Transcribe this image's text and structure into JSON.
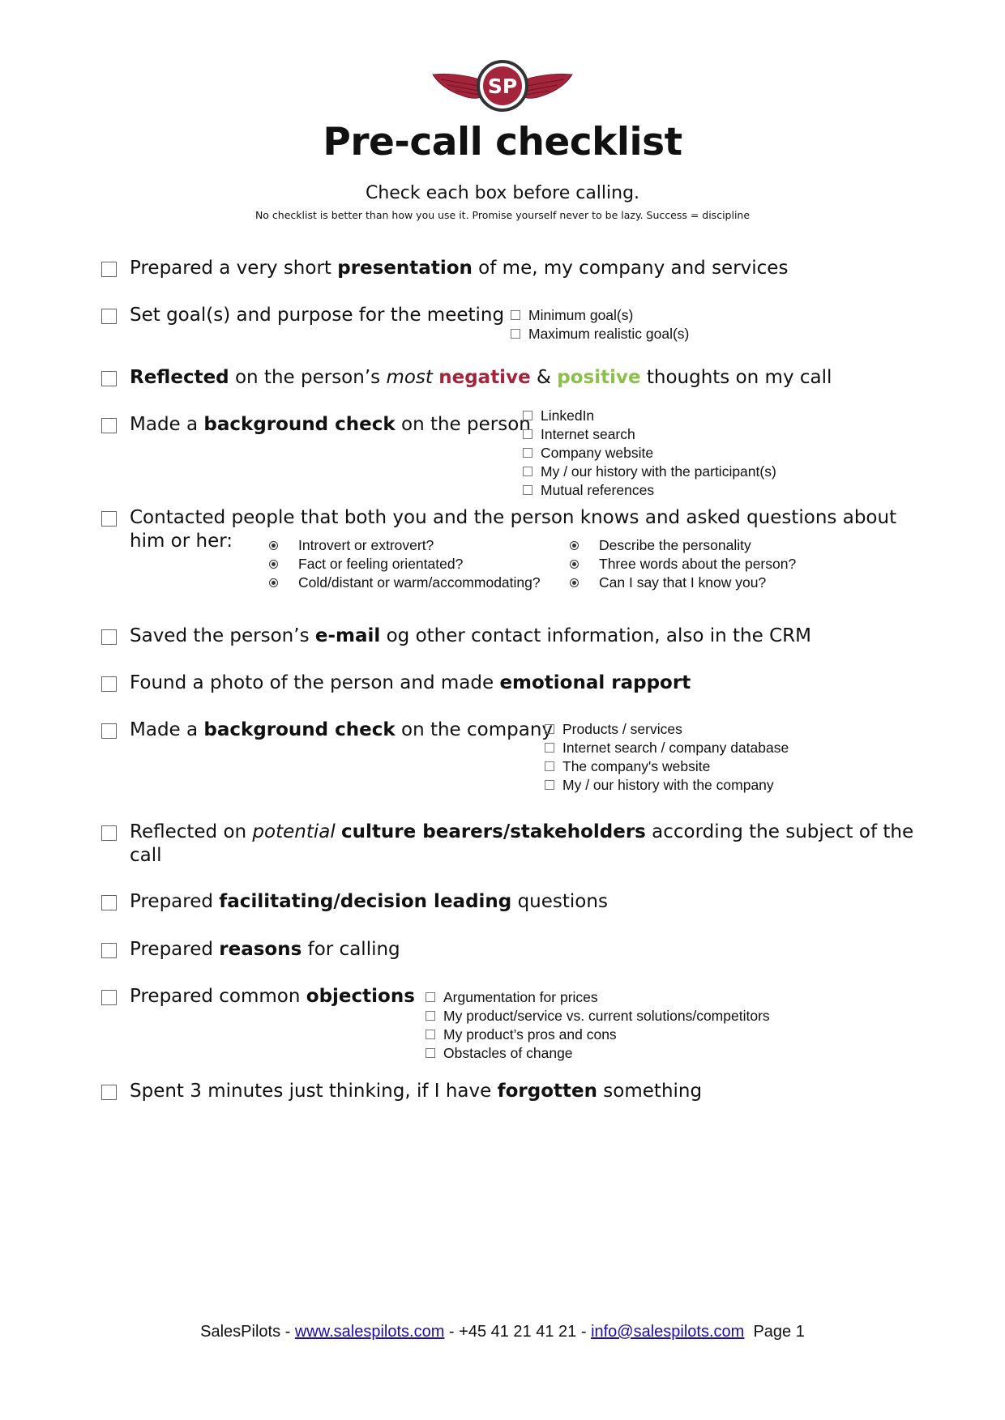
{
  "header": {
    "logo_text": "SP",
    "title": "Pre-call checklist",
    "subtitle": "Check each box before calling.",
    "tagline": "No checklist is better than how you use it. Promise yourself never to be lazy. Success = discipline"
  },
  "colors": {
    "brand_red": "#a3243b",
    "negative": "#a3243b",
    "positive": "#8cc04a",
    "link": "#1a0dab"
  },
  "items": [
    {
      "parts": [
        "Prepared a very short ",
        "presentation",
        " of me, my company and services"
      ]
    },
    {
      "parts": [
        "Set goal(s) and purpose for the meeting"
      ],
      "sub": [
        "Minimum goal(s)",
        "Maximum realistic goal(s)"
      ]
    },
    {
      "parts": [
        "Reflected",
        " on the person’s ",
        "most",
        " ",
        "negative",
        " & ",
        "positive",
        " thoughts on my call"
      ]
    },
    {
      "parts": [
        "Made a ",
        "background check",
        " on the person"
      ],
      "sub": [
        "LinkedIn",
        "Internet search",
        "Company website",
        "My / our history with the participant(s)",
        "Mutual references"
      ]
    },
    {
      "line1": "Contacted people that both you and the person knows and asked questions about",
      "line2": "him or her:",
      "questions_left": [
        "Introvert or extrovert?",
        "Fact or feeling orientated?",
        "Cold/distant or warm/accommodating?"
      ],
      "questions_right": [
        "Describe the personality",
        "Three words about the person?",
        "Can I say that I know you?"
      ]
    },
    {
      "parts": [
        "Saved the person’s ",
        "e-mail",
        " og other contact information, also in the CRM"
      ]
    },
    {
      "parts": [
        "Found a photo of the person and made ",
        "emotional rapport"
      ]
    },
    {
      "parts": [
        "Made a ",
        "background check",
        " on the company"
      ],
      "sub": [
        "Products / services",
        "Internet search / company database",
        "The company's website",
        "My / our history with the company"
      ]
    },
    {
      "parts": [
        "Reflected on ",
        "potential",
        " ",
        "culture bearers/stakeholders",
        " according the subject of the"
      ],
      "line2": "call"
    },
    {
      "parts": [
        "Prepared ",
        "facilitating/decision leading",
        " questions"
      ]
    },
    {
      "parts": [
        "Prepared ",
        "reasons",
        " for calling"
      ]
    },
    {
      "parts": [
        "Prepared common ",
        "objections"
      ],
      "sub": [
        "Argumentation for prices",
        "My product/service vs. current solutions/competitors",
        "My product’s pros and cons",
        "Obstacles of change"
      ]
    },
    {
      "parts": [
        "Spent 3 minutes just thinking, if I have ",
        "forgotten",
        " something"
      ]
    }
  ],
  "footer": {
    "company": "SalesPilots - ",
    "website": "www.salespilots.com",
    "sep1": " - +45 41 21 41 21 - ",
    "email": "info@salespilots.com",
    "page": "  Page 1"
  }
}
